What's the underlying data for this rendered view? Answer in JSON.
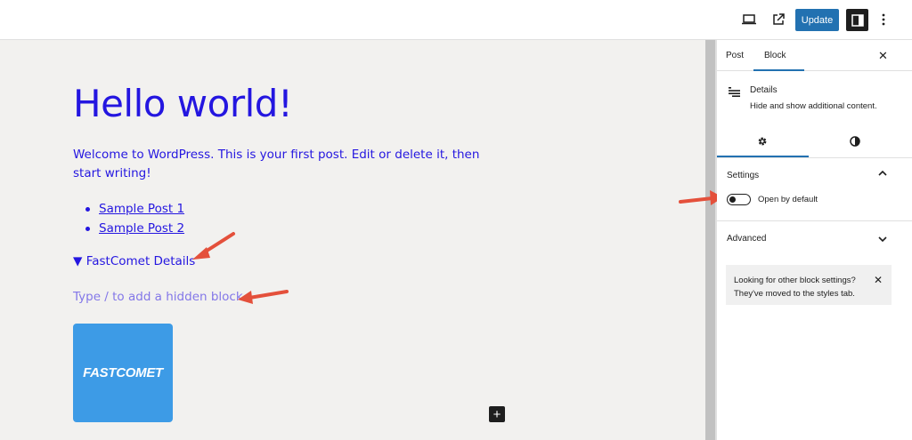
{
  "toolbar": {
    "update_label": "Update"
  },
  "post": {
    "title": "Hello world!",
    "paragraph": "Welcome to WordPress. This is your first post. Edit or delete it, then start writing!",
    "list_items": [
      "Sample Post 1",
      "Sample Post 2"
    ],
    "details_marker": "▼",
    "details_summary": "FastComet Details",
    "hidden_block_placeholder": "Type / to add a hidden block",
    "logo_text": "FASTCOMET",
    "inserter_symbol": "+"
  },
  "sidebar": {
    "tabs": [
      "Post",
      "Block"
    ],
    "active_tab": "Block",
    "close_symbol": "✕",
    "block": {
      "title": "Details",
      "description": "Hide and show additional content."
    },
    "settings": {
      "title": "Settings",
      "chevron": "⌃",
      "toggle_label": "Open by default",
      "toggle_on": false
    },
    "advanced": {
      "title": "Advanced",
      "chevron": "⌄"
    },
    "notice": {
      "line1": "Looking for other block settings?",
      "line2": "They've moved to the styles tab.",
      "close_symbol": "✕"
    }
  },
  "colors": {
    "accent": "#2271b1",
    "post_text": "#2416e0",
    "placeholder": "#8377e8",
    "logo_bg": "#3d9be6",
    "annotation_arrow": "#e4503b"
  }
}
